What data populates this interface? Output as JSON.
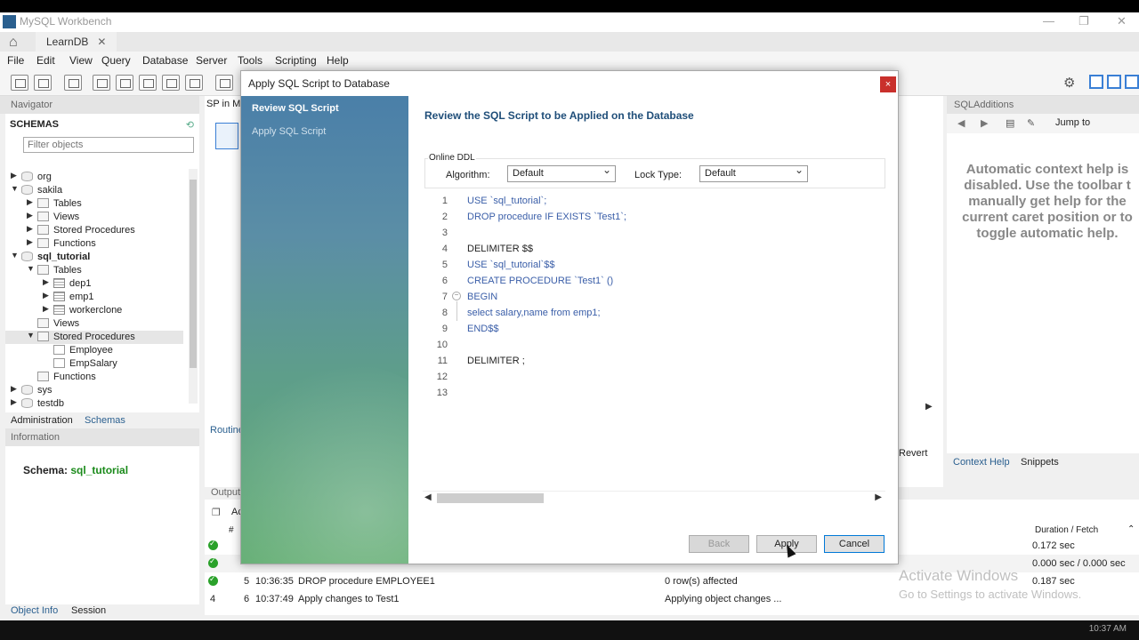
{
  "window": {
    "title": "MySQL Workbench",
    "connection_tab": "LearnDB"
  },
  "menu": [
    "File",
    "Edit",
    "View",
    "Query",
    "Database",
    "Server",
    "Tools",
    "Scripting",
    "Help"
  ],
  "navigator": {
    "header": "Navigator",
    "schemas_label": "SCHEMAS",
    "filter_placeholder": "Filter objects",
    "tree": [
      {
        "label": "org",
        "level": 0,
        "type": "db",
        "expanded": false
      },
      {
        "label": "sakila",
        "level": 0,
        "type": "db",
        "expanded": true
      },
      {
        "label": "Tables",
        "level": 1,
        "type": "folder",
        "expanded": false
      },
      {
        "label": "Views",
        "level": 1,
        "type": "folder",
        "expanded": false
      },
      {
        "label": "Stored Procedures",
        "level": 1,
        "type": "folder",
        "expanded": false
      },
      {
        "label": "Functions",
        "level": 1,
        "type": "folder",
        "expanded": false
      },
      {
        "label": "sql_tutorial",
        "level": 0,
        "type": "db",
        "expanded": true,
        "bold": true
      },
      {
        "label": "Tables",
        "level": 1,
        "type": "folder",
        "expanded": true
      },
      {
        "label": "dep1",
        "level": 2,
        "type": "table",
        "expanded": false
      },
      {
        "label": "emp1",
        "level": 2,
        "type": "table",
        "expanded": false
      },
      {
        "label": "workerclone",
        "level": 2,
        "type": "table",
        "expanded": false
      },
      {
        "label": "Views",
        "level": 1,
        "type": "folder",
        "expanded": null
      },
      {
        "label": "Stored Procedures",
        "level": 1,
        "type": "folder",
        "expanded": true,
        "selected": true
      },
      {
        "label": "Employee",
        "level": 2,
        "type": "proc",
        "expanded": null
      },
      {
        "label": "EmpSalary",
        "level": 2,
        "type": "proc",
        "expanded": null
      },
      {
        "label": "Functions",
        "level": 1,
        "type": "folder",
        "expanded": null
      },
      {
        "label": "sys",
        "level": 0,
        "type": "db",
        "expanded": false
      },
      {
        "label": "testdb",
        "level": 0,
        "type": "db",
        "expanded": false
      }
    ],
    "tabs": {
      "administration": "Administration",
      "schemas": "Schemas"
    }
  },
  "information": {
    "header": "Information",
    "schema_label": "Schema:",
    "schema_value": "sql_tutorial",
    "tabs": {
      "object_info": "Object Info",
      "session": "Session"
    }
  },
  "editor": {
    "tab_label": "SP in M",
    "routine_label": "Routine",
    "revert_label": "Revert"
  },
  "sql_additions": {
    "header": "SQLAdditions",
    "jump_to": "Jump to",
    "help_lines": [
      "Automatic context help is",
      "disabled. Use the toolbar t",
      "manually get help for the",
      "current caret position or to",
      "toggle automatic help."
    ],
    "tabs": {
      "context_help": "Context Help",
      "snippets": "Snippets"
    }
  },
  "output": {
    "header": "Output",
    "action_col": "Ac",
    "hash_col": "#",
    "duration_col": "Duration / Fetch",
    "rows": [
      {
        "status": "ok",
        "idx": "",
        "time": "",
        "action": "",
        "message": "",
        "duration": "0.172 sec"
      },
      {
        "status": "ok",
        "idx": "",
        "time": "",
        "action": "",
        "message": "",
        "duration": "0.000 sec / 0.000 sec"
      },
      {
        "status": "ok",
        "idx": "5",
        "time": "10:36:35",
        "action": "DROP procedure EMPLOYEE1",
        "message": "0 row(s) affected",
        "duration": "0.187 sec"
      },
      {
        "status": "none",
        "row_num": "4",
        "idx": "6",
        "time": "10:37:49",
        "action": "Apply changes to Test1",
        "message": "Applying object changes ...",
        "duration": ""
      }
    ]
  },
  "watermark": {
    "line1": "Activate Windows",
    "line2": "Go to Settings to activate Windows."
  },
  "dialog": {
    "title": "Apply SQL Script to Database",
    "close_symbol": "×",
    "steps": [
      "Review SQL Script",
      "Apply SQL Script"
    ],
    "heading": "Review the SQL Script to be Applied on the Database",
    "online_ddl": {
      "legend": "Online DDL",
      "algorithm_label": "Algorithm:",
      "algorithm_value": "Default",
      "lock_label": "Lock Type:",
      "lock_value": "Default"
    },
    "script": [
      {
        "n": "1",
        "text": "USE `sql_tutorial`;",
        "kw": true
      },
      {
        "n": "2",
        "text": "DROP procedure IF EXISTS `Test1`;",
        "kw": true
      },
      {
        "n": "3",
        "text": "",
        "kw": false
      },
      {
        "n": "4",
        "text": "DELIMITER $$",
        "kw": false
      },
      {
        "n": "5",
        "text": "USE `sql_tutorial`$$",
        "kw": true
      },
      {
        "n": "6",
        "text": "CREATE PROCEDURE `Test1` ()",
        "kw": true
      },
      {
        "n": "7",
        "text": "BEGIN",
        "kw": true
      },
      {
        "n": "8",
        "text": "select salary,name from emp1;",
        "kw": "mixed"
      },
      {
        "n": "9",
        "text": "END$$",
        "kw": true
      },
      {
        "n": "10",
        "text": "",
        "kw": false
      },
      {
        "n": "11",
        "text": "DELIMITER ;",
        "kw": false
      },
      {
        "n": "12",
        "text": "",
        "kw": false
      },
      {
        "n": "13",
        "text": "",
        "kw": false
      }
    ],
    "buttons": {
      "back": "Back",
      "apply": "Apply",
      "cancel": "Cancel"
    }
  },
  "taskbar": {
    "clock": "10:37 AM"
  },
  "colors": {
    "accent": "#1f4e79",
    "ok": "#2aa12a",
    "keyword": "#3a5ea8"
  }
}
